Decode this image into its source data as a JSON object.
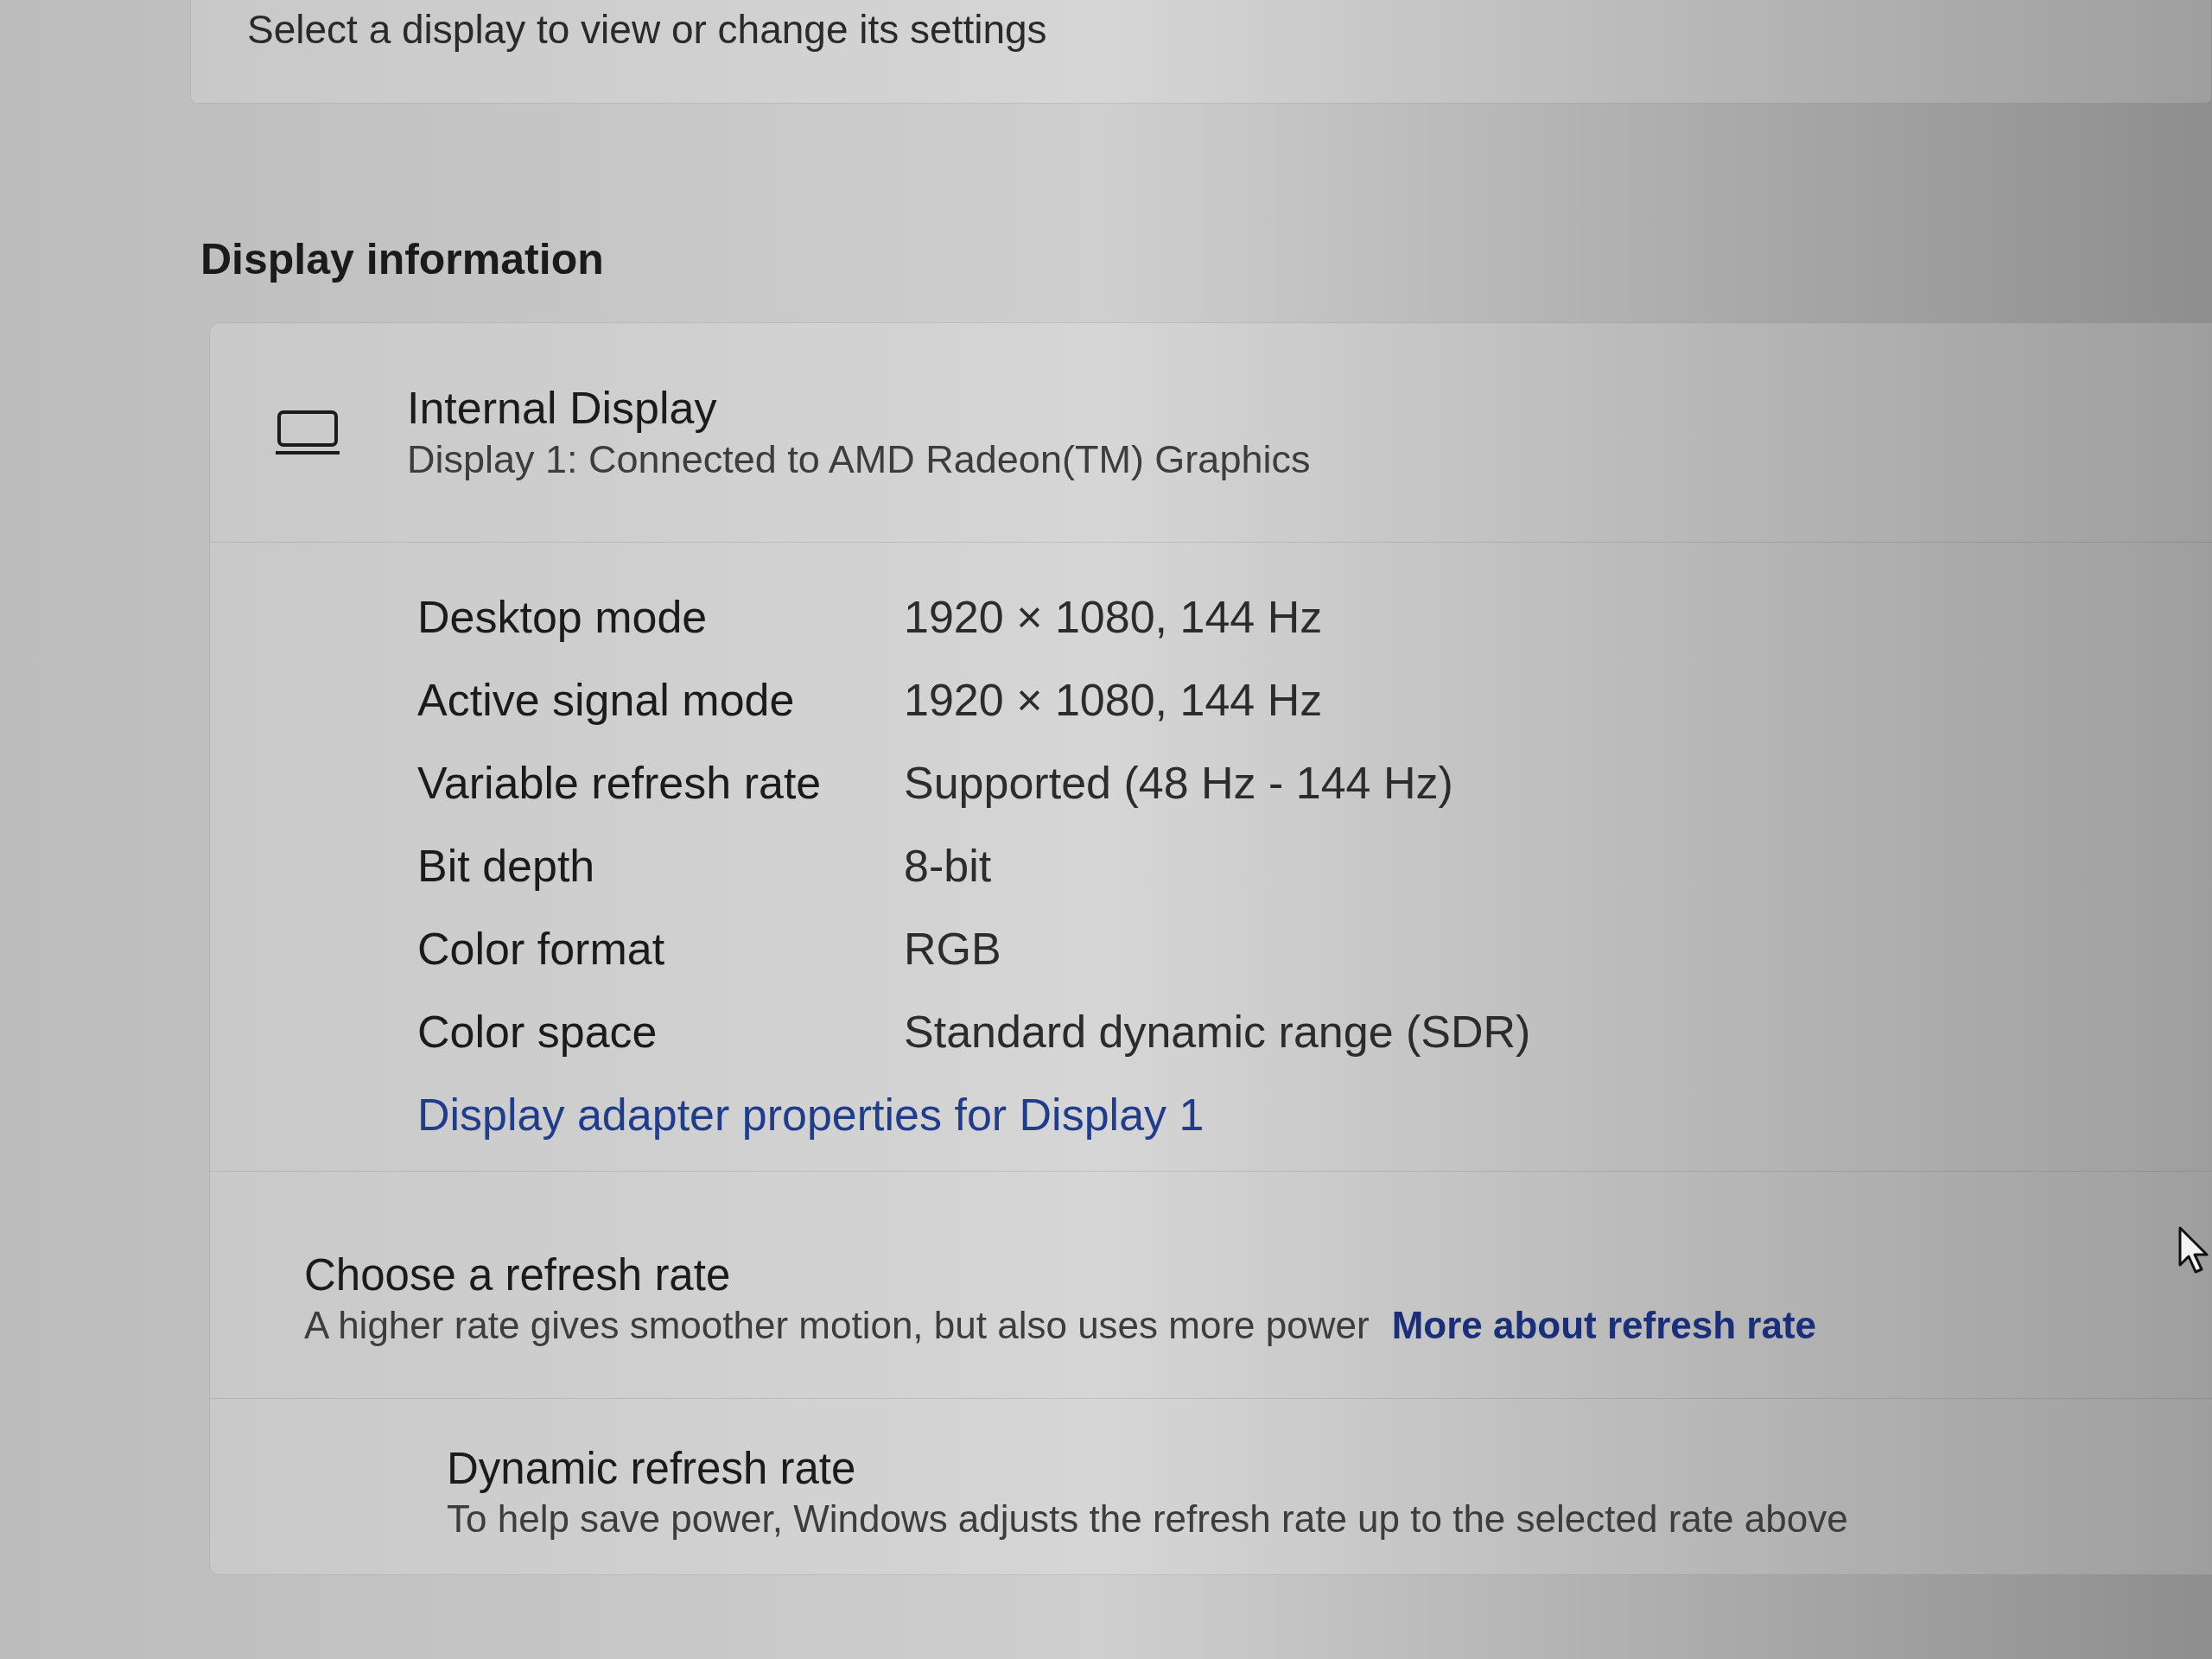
{
  "header_hint": "Select a display to view or change its settings",
  "section_title": "Display information",
  "display": {
    "name": "Internal Display",
    "description": "Display 1: Connected to AMD Radeon(TM) Graphics"
  },
  "properties": [
    {
      "label": "Desktop mode",
      "value": "1920 × 1080, 144 Hz"
    },
    {
      "label": "Active signal mode",
      "value": "1920 × 1080, 144 Hz"
    },
    {
      "label": "Variable refresh rate",
      "value": "Supported (48 Hz - 144 Hz)"
    },
    {
      "label": "Bit depth",
      "value": "8-bit"
    },
    {
      "label": "Color format",
      "value": "RGB"
    },
    {
      "label": "Color space",
      "value": "Standard dynamic range (SDR)"
    }
  ],
  "adapter_link": "Display adapter properties for Display 1",
  "refresh_rate": {
    "title": "Choose a refresh rate",
    "description": "A higher rate gives smoother motion, but also uses more power",
    "link": "More about refresh rate",
    "children": [
      {
        "title": "Dynamic refresh rate",
        "description": "To help save power, Windows adjusts the refresh rate up to the selected rate above"
      }
    ]
  }
}
